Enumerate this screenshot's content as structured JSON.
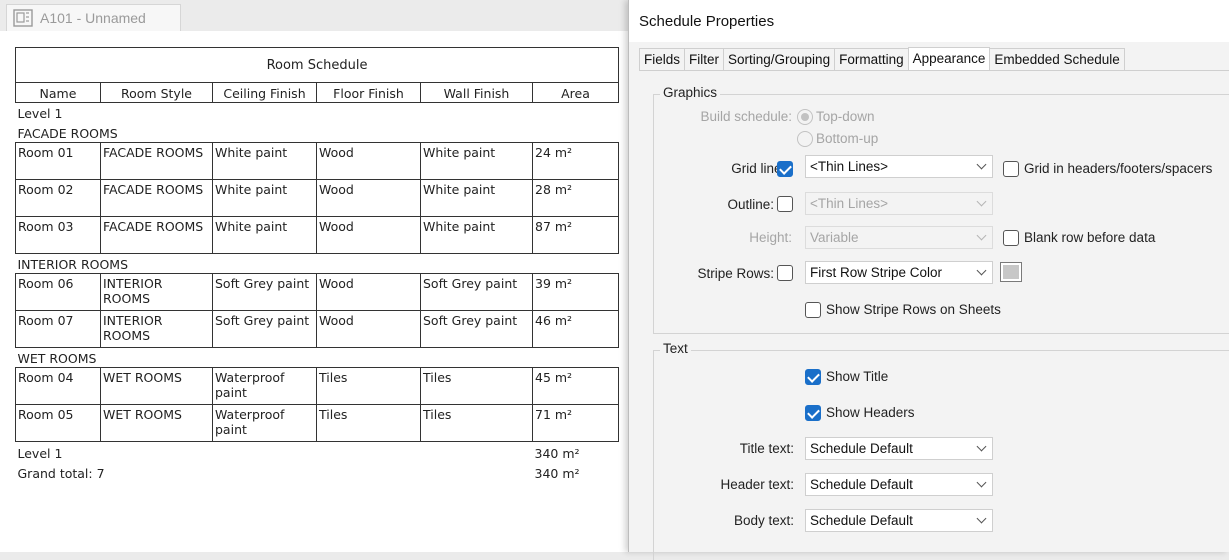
{
  "view_tab": {
    "title": "A101 - Unnamed",
    "icon": "sheet-icon"
  },
  "schedule": {
    "title": "Room Schedule",
    "columns": [
      "Name",
      "Room Style",
      "Ceiling Finish",
      "Floor Finish",
      "Wall Finish",
      "Area"
    ],
    "level_label": "Level 1",
    "groups": [
      {
        "name": "FACADE ROOMS",
        "rows": [
          [
            "Room 01",
            "FACADE ROOMS",
            "White paint",
            "Wood",
            "White paint",
            "24 m²"
          ],
          [
            "Room 02",
            "FACADE ROOMS",
            "White paint",
            "Wood",
            "White paint",
            "28 m²"
          ],
          [
            "Room 03",
            "FACADE ROOMS",
            "White paint",
            "Wood",
            "White paint",
            "87 m²"
          ]
        ]
      },
      {
        "name": "INTERIOR ROOMS",
        "rows": [
          [
            "Room 06",
            "INTERIOR ROOMS",
            "Soft Grey paint",
            "Wood",
            "Soft Grey paint",
            "39 m²"
          ],
          [
            "Room 07",
            "INTERIOR ROOMS",
            "Soft Grey paint",
            "Wood",
            "Soft Grey paint",
            "46 m²"
          ]
        ]
      },
      {
        "name": "WET ROOMS",
        "rows": [
          [
            "Room 04",
            "WET ROOMS",
            "Waterproof paint",
            "Tiles",
            "Tiles",
            "45 m²"
          ],
          [
            "Room 05",
            "WET ROOMS",
            "Waterproof paint",
            "Tiles",
            "Tiles",
            "71 m²"
          ]
        ]
      }
    ],
    "level_total_label": "Level 1",
    "level_total_area": "340 m²",
    "grand_total_label": "Grand total: 7",
    "grand_total_area": "340 m²"
  },
  "dialog": {
    "title": "Schedule Properties",
    "tabs": [
      "Fields",
      "Filter",
      "Sorting/Grouping",
      "Formatting",
      "Appearance",
      "Embedded Schedule"
    ],
    "active_tab": "Appearance",
    "graphics": {
      "group_label": "Graphics",
      "build_schedule_label": "Build schedule:",
      "top_down_label": "Top-down",
      "bottom_up_label": "Bottom-up",
      "grid_lines_label": "Grid lines:",
      "grid_lines_checked": true,
      "grid_lines_value": "<Thin Lines>",
      "grid_in_headers_label": "Grid in headers/footers/spacers",
      "grid_in_headers_checked": false,
      "outline_label": "Outline:",
      "outline_checked": false,
      "outline_value": "<Thin Lines>",
      "height_label": "Height:",
      "height_value": "Variable",
      "blank_row_label": "Blank row before data",
      "blank_row_checked": false,
      "stripe_rows_label": "Stripe Rows:",
      "stripe_rows_checked": false,
      "stripe_value": "First Row Stripe Color",
      "stripe_color": "#c7c7c7",
      "show_stripe_sheets_label": "Show Stripe Rows on Sheets",
      "show_stripe_sheets_checked": false
    },
    "text": {
      "group_label": "Text",
      "show_title_label": "Show Title",
      "show_title_checked": true,
      "show_headers_label": "Show Headers",
      "show_headers_checked": true,
      "title_text_label": "Title text:",
      "title_text_value": "Schedule Default",
      "header_text_label": "Header text:",
      "header_text_value": "Schedule Default",
      "body_text_label": "Body text:",
      "body_text_value": "Schedule Default"
    },
    "accent_color": "#1a6fc9"
  }
}
